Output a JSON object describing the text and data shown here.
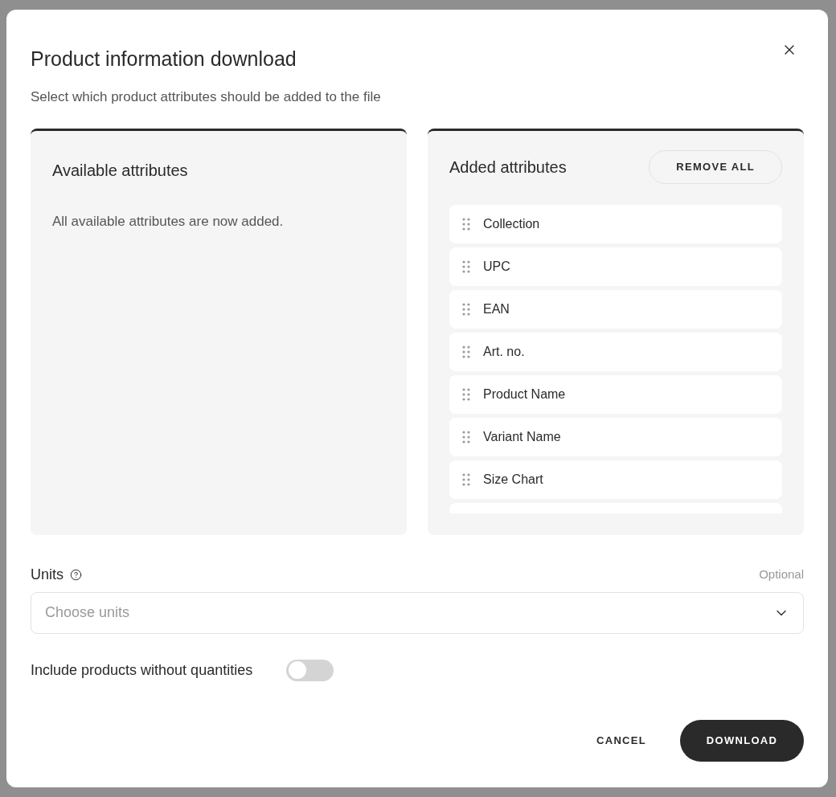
{
  "dialog": {
    "title": "Product information download",
    "subtitle": "Select which product attributes should be added to the file"
  },
  "available": {
    "title": "Available attributes",
    "empty_message": "All available attributes are now added."
  },
  "added": {
    "title": "Added attributes",
    "remove_all": "REMOVE ALL",
    "items": [
      {
        "label": "Collection"
      },
      {
        "label": "UPC"
      },
      {
        "label": "EAN"
      },
      {
        "label": "Art. no."
      },
      {
        "label": "Product Name"
      },
      {
        "label": "Variant Name"
      },
      {
        "label": "Size Chart"
      }
    ]
  },
  "units": {
    "label": "Units",
    "optional": "Optional",
    "placeholder": "Choose units"
  },
  "include_toggle": {
    "label": "Include products without quantities",
    "on": false
  },
  "buttons": {
    "cancel": "CANCEL",
    "download": "DOWNLOAD"
  }
}
